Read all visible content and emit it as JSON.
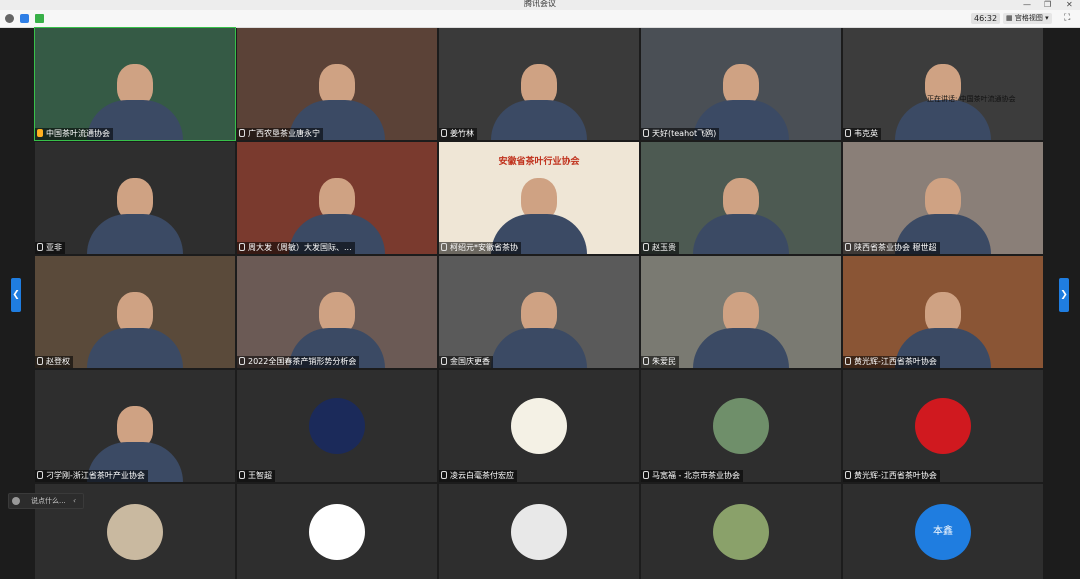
{
  "window": {
    "title": "腾讯会议"
  },
  "toolbar": {
    "timer": "46:32",
    "view_label": "宫格视图"
  },
  "speaking_indicator": "正在讲话: 中国茶叶流通协会",
  "chat": {
    "placeholder": "说点什么..."
  },
  "participants": [
    {
      "name": "中国茶叶流通协会",
      "speaking": true
    },
    {
      "name": "广西农垦茶业唐永宁"
    },
    {
      "name": "姜竹林"
    },
    {
      "name": "天好(teahot飞鸥)"
    },
    {
      "name": "韦克英"
    },
    {
      "name": "亚非"
    },
    {
      "name": "周大发（周敏）大发国际、..."
    },
    {
      "name": "柯绍元*安徽省茶协",
      "banner_title": "安徽省茶叶行业协会"
    },
    {
      "name": "赵玉贵"
    },
    {
      "name": "陕西省茶业协会 穆世超"
    },
    {
      "name": "赵登权"
    },
    {
      "name": "2022全国春茶产销形势分析会"
    },
    {
      "name": "金国庆更香"
    },
    {
      "name": "朱爱民"
    },
    {
      "name": "黄光辉-江西省茶叶协会"
    },
    {
      "name": "刁学刚-浙江省茶叶产业协会"
    },
    {
      "name": "王智超"
    },
    {
      "name": "凌云白毫茶付宏应"
    },
    {
      "name": "马宽福 - 北京市茶业协会"
    },
    {
      "name": "黄光辉-江西省茶叶协会"
    },
    {
      "name": ""
    },
    {
      "name": ""
    },
    {
      "name": ""
    },
    {
      "name": ""
    },
    {
      "name": "",
      "avatar_text": "本鑫"
    }
  ],
  "colors": {
    "accent": "#1f7de0",
    "speaker": "#ffb020"
  }
}
